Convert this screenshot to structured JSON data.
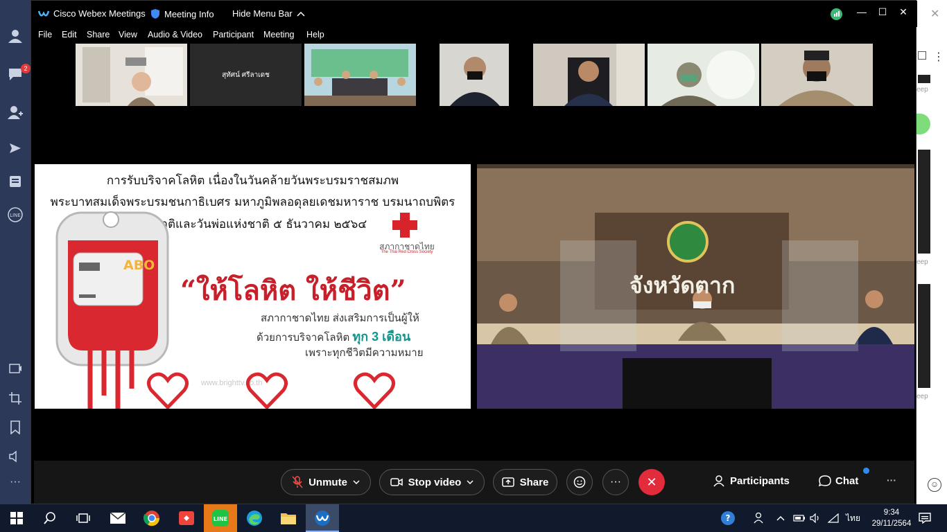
{
  "window": {
    "app_title": "Cisco Webex Meetings",
    "meeting_info": "Meeting Info",
    "hide_menu": "Hide Menu Bar"
  },
  "menu": [
    "File",
    "Edit",
    "Share",
    "View",
    "Audio & Video",
    "Participant",
    "Meeting",
    "Help"
  ],
  "thumbnails": {
    "named_participant": "สุทัศน์ ศรีลาเดช"
  },
  "shared_content": {
    "line1": "การรับบริจาคโลหิต เนื่องในวันคล้ายวันพระบรมราชสมภพ",
    "line2": "พระบาทสมเด็จพระบรมชนกาธิเบศร มหาภูมิพลอดุลยเดชมหาราช บรมนาถบพิตร",
    "line3": "วันชาติและวันพ่อแห่งชาติ ๕ ธันวาคม ๒๕๖๔",
    "bag_label": "ABO",
    "org_thai": "สภากาชาดไทย",
    "org_en": "The Thai Red Cross Society",
    "slogan": "“ให้โลหิต ให้ชีวิต”",
    "tag1": "สภากาชาดไทย ส่งเสริมการเป็นผู้ให้",
    "tag2_a": "ด้วยการบริจาคโลหิต ",
    "tag2_b": "ทุก 3 เดือน",
    "tag3": "เพราะทุกชีวิตมีความหมาย",
    "watermark": "www.brighttv.co.th"
  },
  "video": {
    "sign_text": "จังหวัดตาก"
  },
  "controls": {
    "unmute": "Unmute",
    "stop_video": "Stop video",
    "share": "Share",
    "participants": "Participants",
    "chat": "Chat",
    "more": "···"
  },
  "background_app": {
    "label": "eep"
  },
  "taskbar": {
    "language": "ไทย",
    "time": "9:34",
    "date": "29/11/2564"
  },
  "badges": {
    "chat_count": "2"
  },
  "colors": {
    "end_call": "#e22b3b",
    "thai_red_cross": "#d8232a",
    "slogan_red": "#c8202a",
    "tag_teal": "#12958f"
  }
}
